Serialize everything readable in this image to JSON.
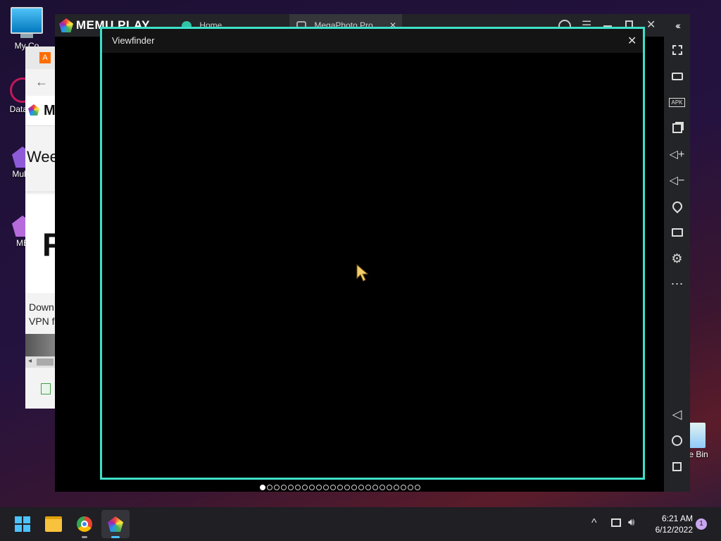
{
  "desktop": {
    "icons": [
      {
        "label": "My Co"
      },
      {
        "label": "DataW"
      },
      {
        "label": "Multi-"
      },
      {
        "label": "ME"
      },
      {
        "label": "e Bin"
      }
    ]
  },
  "background_window": {
    "badge": "A",
    "heading": "Wee",
    "snippet_line1": "Down",
    "snippet_line2": "VPN f",
    "logo_text": "M",
    "big_glyph": "F"
  },
  "memu": {
    "brand": "MEMU PLAY",
    "tabs": [
      {
        "label": "Home"
      },
      {
        "label": "MegaPhoto Pro"
      }
    ],
    "sidebar_icons": [
      "collapse-icon",
      "fullscreen-icon",
      "keyboard-icon",
      "apk-icon",
      "multi-instance-icon",
      "volume-up-icon",
      "volume-down-icon",
      "location-icon",
      "folder-icon",
      "settings-icon",
      "more-icon",
      "back-icon",
      "home-icon",
      "recent-apps-icon"
    ],
    "apk_label": "APK",
    "more_label": "⋯"
  },
  "viewfinder": {
    "title": "Viewfinder",
    "close": "✕",
    "border_color": "#3de0c8"
  },
  "pager": {
    "total": 23,
    "active_index": 0
  },
  "taskbar": {
    "time": "6:21 AM",
    "date": "6/12/2022",
    "notification_count": "1",
    "chevron": "^"
  }
}
